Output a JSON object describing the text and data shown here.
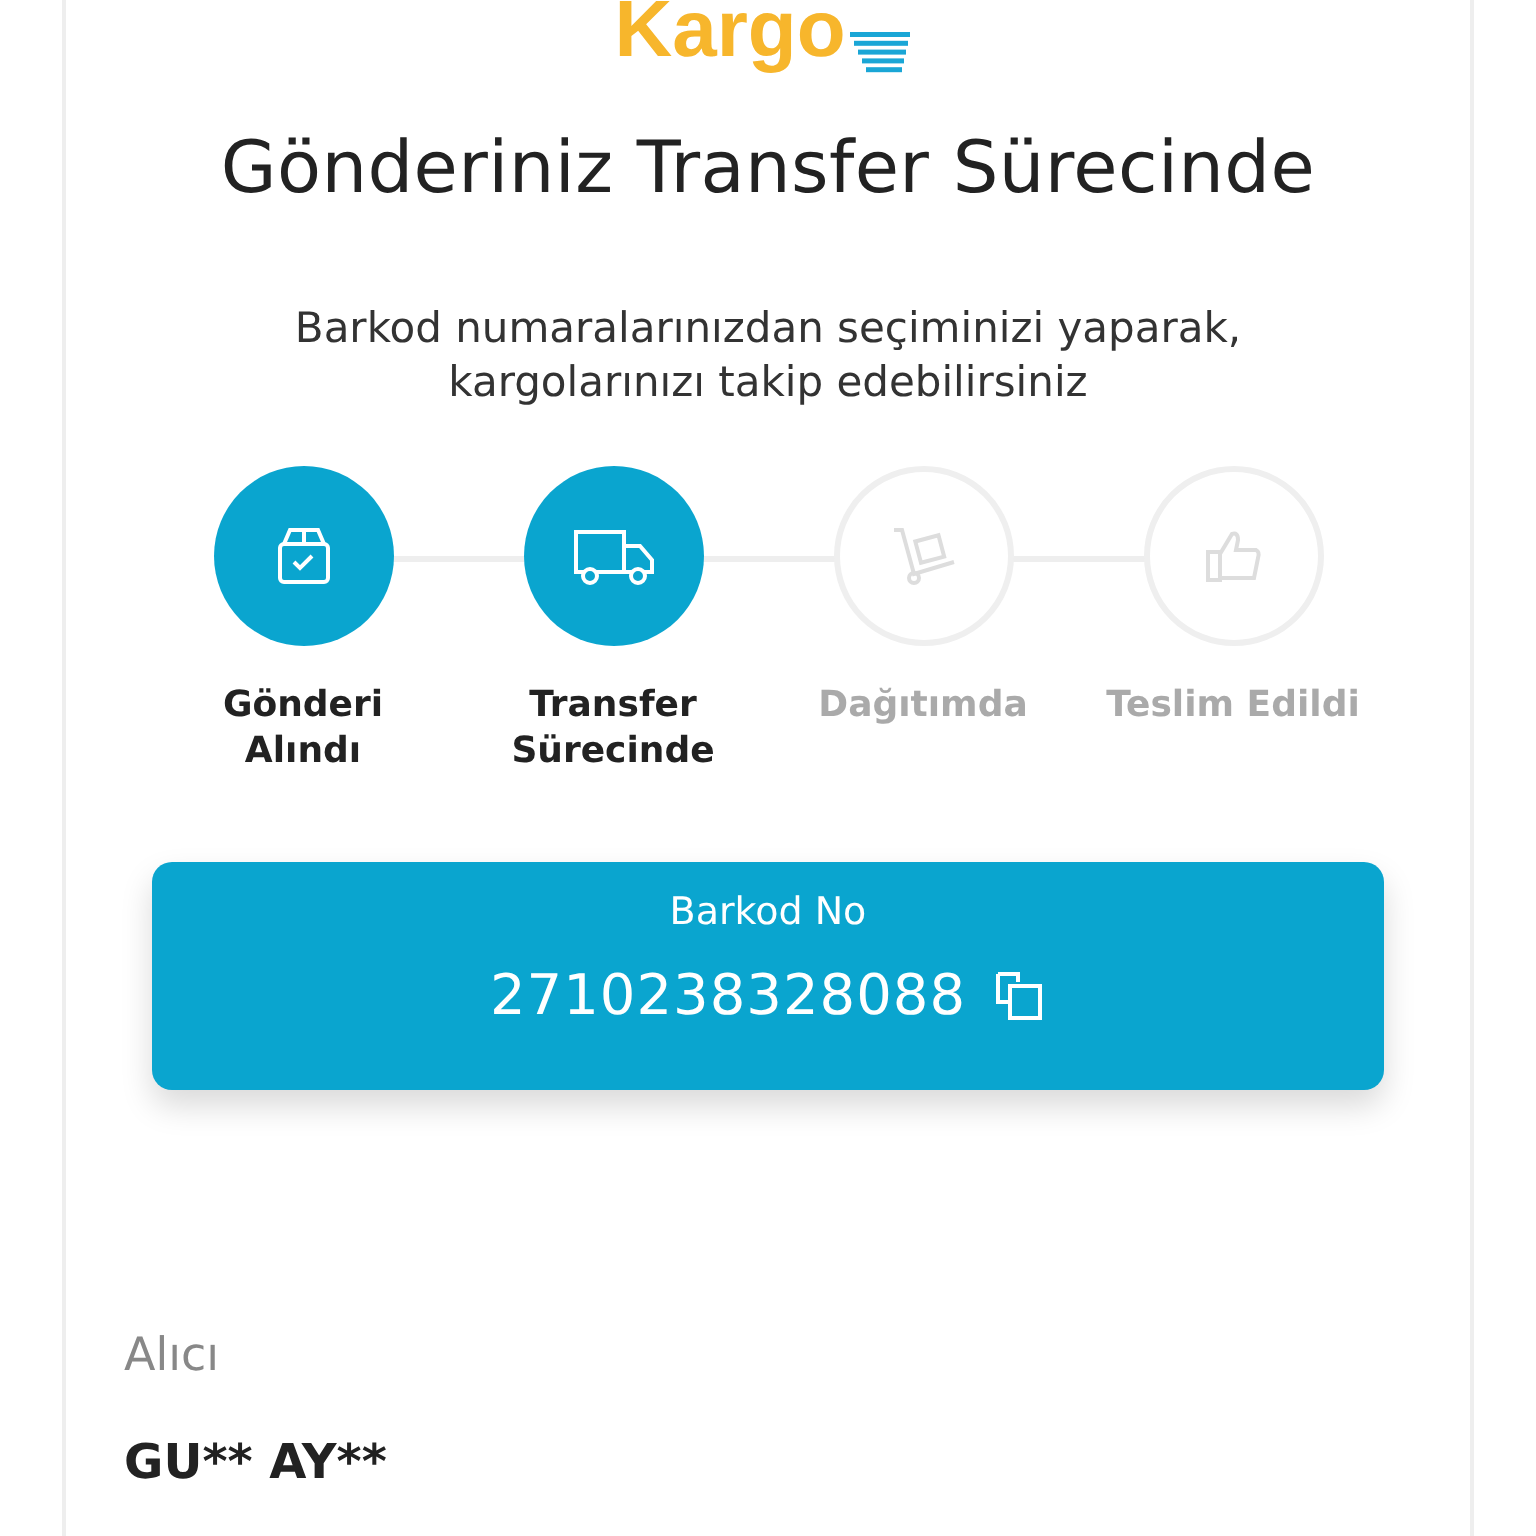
{
  "logo": {
    "text": "Kargo"
  },
  "title": "Gönderiniz Transfer Sürecinde",
  "subtitle": "Barkod numaralarınızdan seçiminizi yaparak, kargolarınızı takip edebilirsiniz",
  "steps": [
    {
      "label": "Gönderi Alındı",
      "kind": "box",
      "completed": true
    },
    {
      "label": "Transfer Sürecinde",
      "kind": "truck",
      "completed": true
    },
    {
      "label": "Dağıtımda",
      "kind": "cart",
      "completed": false
    },
    {
      "label": "Teslim Edildi",
      "kind": "thumb",
      "completed": false
    }
  ],
  "barcode": {
    "label": "Barkod No",
    "value": "2710238328088"
  },
  "recipient": {
    "label": "Alıcı",
    "name": "GU** AY**"
  }
}
